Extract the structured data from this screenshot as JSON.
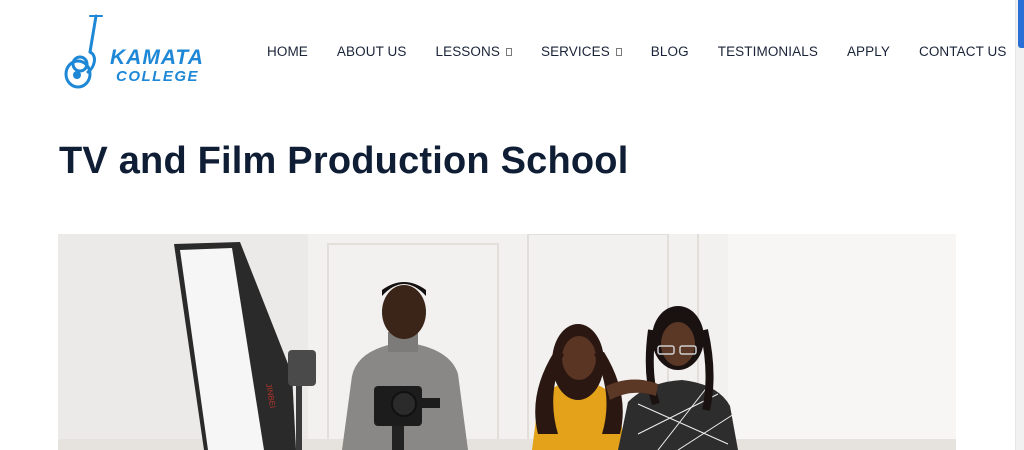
{
  "site": {
    "logo_text_top": "KAMATA",
    "logo_text_bottom": "COLLEGE"
  },
  "nav": {
    "items": [
      {
        "label": "HOME"
      },
      {
        "label": "ABOUT US"
      },
      {
        "label": "LESSONS",
        "dropdown": true
      },
      {
        "label": "SERVICES",
        "dropdown": true
      },
      {
        "label": "BLOG"
      },
      {
        "label": "TESTIMONIALS"
      },
      {
        "label": "APPLY"
      },
      {
        "label": "CONTACT US"
      }
    ]
  },
  "main": {
    "title": "TV and Film Production School",
    "hero_image": "photo of three students with camera and studio softbox light"
  },
  "colors": {
    "brand_blue": "#1e88d6",
    "heading": "#0f1e35",
    "nav_text": "#1a2438",
    "scroll_thumb": "#2a6fd6"
  },
  "icons": {
    "dropdown_caret": "chevron-down-icon"
  }
}
